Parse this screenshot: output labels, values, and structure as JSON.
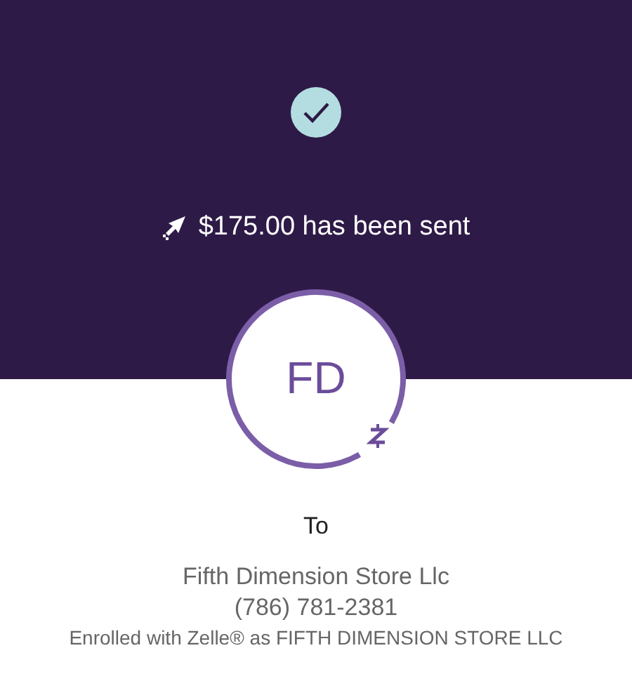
{
  "status": {
    "title": "$175.00 has been sent"
  },
  "recipient": {
    "initials": "FD",
    "label": "To",
    "name": "Fifth Dimension Store Llc",
    "phone": "(786) 781-2381",
    "enrollment": "Enrolled with Zelle® as FIFTH DIMENSION STORE LLC"
  }
}
